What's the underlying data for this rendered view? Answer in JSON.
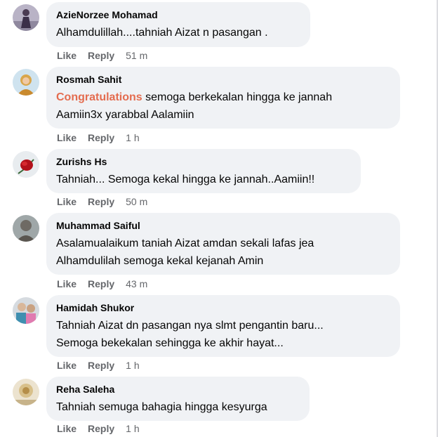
{
  "actions": {
    "like": "Like",
    "reply": "Reply"
  },
  "comments": [
    {
      "author": "AzieNorzee Mohamad",
      "lines": [
        "Alhamdulillah....tahniah Aizat n pasangan ."
      ],
      "time": "51 m"
    },
    {
      "author": "Rosmah Sahit",
      "highlight": "Congratulations",
      "lines": [
        " semoga berkekalan hingga ke jannah",
        "Aamiin3x yarabbal Aalamiin"
      ],
      "time": "1 h"
    },
    {
      "author": "Zurishs Hs",
      "lines": [
        "Tahniah... Semoga kekal hingga ke jannah..Aamiin!!"
      ],
      "time": "50 m"
    },
    {
      "author": "Muhammad Saiful",
      "lines": [
        "Asalamualaikum taniah Aizat amdan sekali lafas jea",
        "Alhamdulilah semoga kekal kejanah Amin"
      ],
      "time": "43 m"
    },
    {
      "author": "Hamidah Shukor",
      "lines": [
        "Tahniah Aizat dn pasangan nya slmt pengantin baru...",
        "Semoga bekekalan sehingga ke akhir hayat..."
      ],
      "time": "1 h"
    },
    {
      "author": "Reha Saleha",
      "lines": [
        "Tahniah semuga bahagia hingga kesyurga"
      ],
      "time": "1 h"
    }
  ]
}
